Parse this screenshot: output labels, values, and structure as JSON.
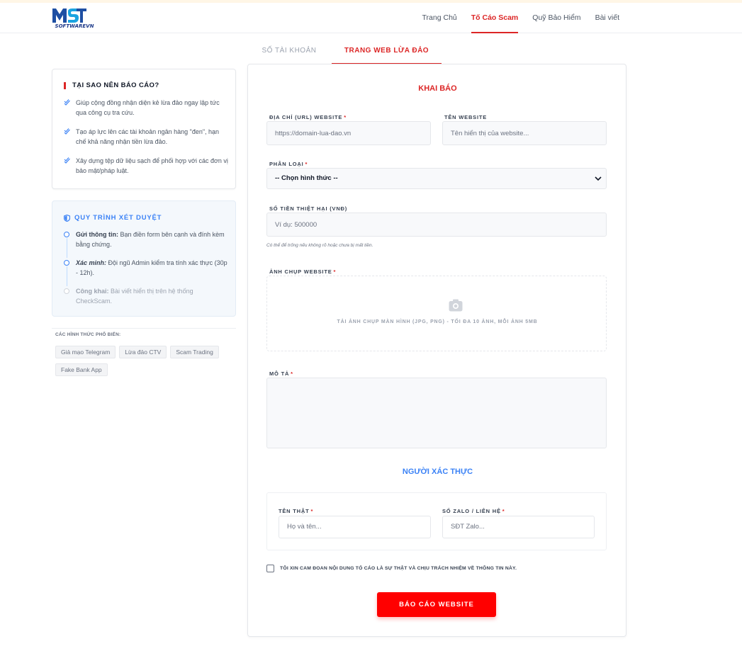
{
  "header": {
    "logo_text": "SOFTWAREVN",
    "nav": [
      {
        "label": "Trang Chủ",
        "active": false
      },
      {
        "label": "Tố Cáo Scam",
        "active": true
      },
      {
        "label": "Quỹ Bảo Hiểm",
        "active": false
      },
      {
        "label": "Bài viết",
        "active": false
      }
    ]
  },
  "tabs": [
    {
      "label": "SỐ TÀI KHOẢN",
      "active": false
    },
    {
      "label": "TRANG WEB LỪA ĐẢO",
      "active": true
    }
  ],
  "why": {
    "title": "TẠI SAO NÊN BÁO CÁO?",
    "items": [
      "Giúp cộng đồng nhận diện kẻ lừa đảo ngay lập tức qua công cụ tra cứu.",
      "Tạo áp lực lên các tài khoản ngân hàng \"đen\", hạn chế khả năng nhận tiền lừa đảo.",
      "Xây dựng tệp dữ liệu sạch để phối hợp với các đơn vị bảo mật/pháp luật."
    ]
  },
  "process": {
    "title": "QUY TRÌNH XÉT DUYỆT",
    "steps": [
      {
        "head": "Gửi thông tin:",
        "text": " Bạn điền form bên cạnh và đính kèm bằng chứng."
      },
      {
        "head": "Xác minh:",
        "text": " Đội ngũ Admin kiểm tra tính xác thực (30p - 12h)."
      },
      {
        "head": "Công khai:",
        "text": " Bài viết hiển thị trên hệ thống CheckScam."
      }
    ]
  },
  "popular": {
    "title": "CÁC HÌNH THỨC PHỔ BIẾN:",
    "chips": [
      "Giả mạo Telegram",
      "Lừa đảo CTV",
      "Scam Trading",
      "Fake Bank App"
    ]
  },
  "form": {
    "title": "KHAI BÁO",
    "url_label": "ĐỊA CHỈ (URL) WEBSITE",
    "url_placeholder": "https://domain-lua-dao.vn",
    "name_label": "TÊN WEBSITE",
    "name_placeholder": "Tên hiển thị của website...",
    "category_label": "PHÂN LOẠI",
    "category_value": "-- Chọn hình thức --",
    "amount_label": "SỐ TIỀN THIỆT HẠI (VNĐ)",
    "amount_placeholder": "Ví dụ: 500000",
    "amount_hint": "Có thể để trống nếu không rõ hoặc chưa bị mất tiền.",
    "screenshot_label": "ẢNH CHỤP WEBSITE",
    "screenshot_caption": "TẢI ẢNH CHỤP MÀN HÌNH (JPG, PNG) - TỐI ĐA 10 ẢNH, MỖI ẢNH 5MB",
    "desc_label": "MÔ TẢ",
    "verifier_title": "NGƯỜI XÁC THỰC",
    "realname_label": "TÊN THẬT",
    "realname_placeholder": "Họ và tên...",
    "zalo_label": "SỐ ZALO / LIÊN HỆ",
    "zalo_placeholder": "SĐT Zalo...",
    "agree_text": "TÔI XIN CAM ĐOAN NỘI DUNG TỐ CÁO LÀ SỰ THẬT VÀ CHỊU TRÁCH NHIỆM VỀ THÔNG TIN NÀY.",
    "required_mark": "*",
    "submit_label": "BÁO CÁO WEBSITE"
  },
  "colors": {
    "accent_red": "#dc2626",
    "button_red": "#ff0000",
    "accent_blue": "#3b82f6"
  }
}
